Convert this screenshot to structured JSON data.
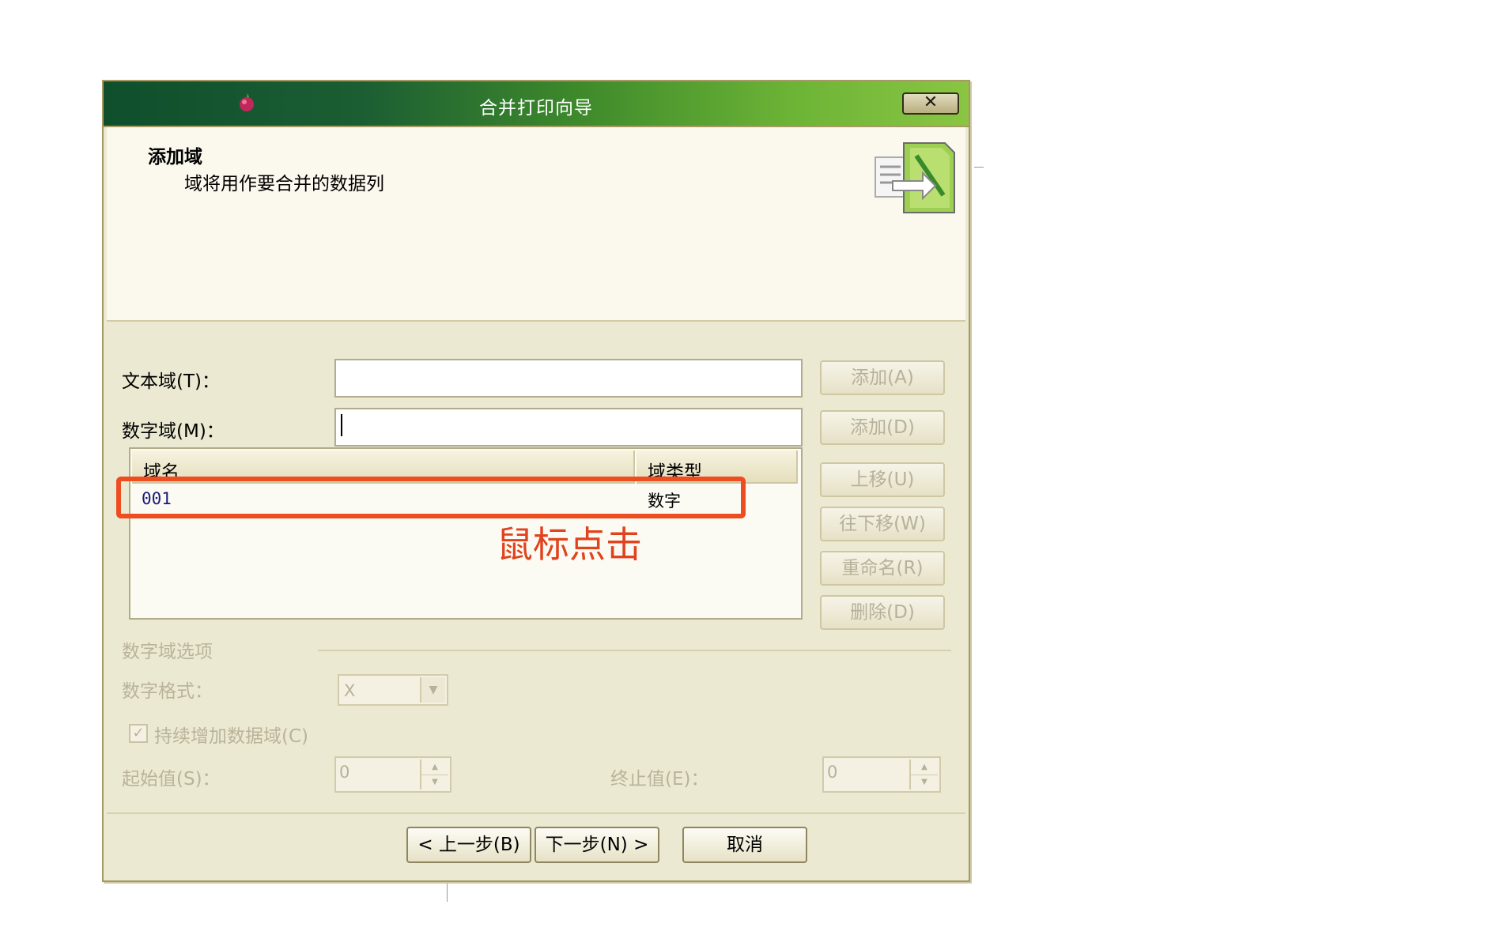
{
  "window": {
    "title": "合并打印向导",
    "close_glyph": "✕"
  },
  "header": {
    "title": "添加域",
    "subtitle": "域将用作要合并的数据列"
  },
  "fields": {
    "text_field_label": "文本域(T)：",
    "number_field_label": "数字域(M)：",
    "text_field_value": "",
    "number_field_value": ""
  },
  "buttons": {
    "add_text": "添加(A)",
    "add_number": "添加(D)",
    "move_up": "上移(U)",
    "move_down": "往下移(W)",
    "rename": "重命名(R)",
    "delete": "删除(D)",
    "back": "< 上一步(B)",
    "next": "下一步(N) >",
    "cancel": "取消"
  },
  "list": {
    "columns": [
      "域名",
      "域类型"
    ],
    "rows": [
      {
        "name": "001",
        "type": "数字"
      }
    ]
  },
  "annotation": "鼠标点击",
  "number_options": {
    "section_label": "数字域选项",
    "format_label": "数字格式：",
    "format_value": "X",
    "increment_label": "持续增加数据域(C)",
    "increment_checked": true,
    "check_glyph": "✓",
    "start_label": "起始值(S)：",
    "start_value": "0",
    "end_label": "终止值(E)：",
    "end_value": "0"
  },
  "colors": {
    "annotation_red": "#e0431e",
    "highlight_border": "#ee4d20",
    "title_bar_dark": "#0f4f2c",
    "title_bar_light": "#8ac543"
  }
}
